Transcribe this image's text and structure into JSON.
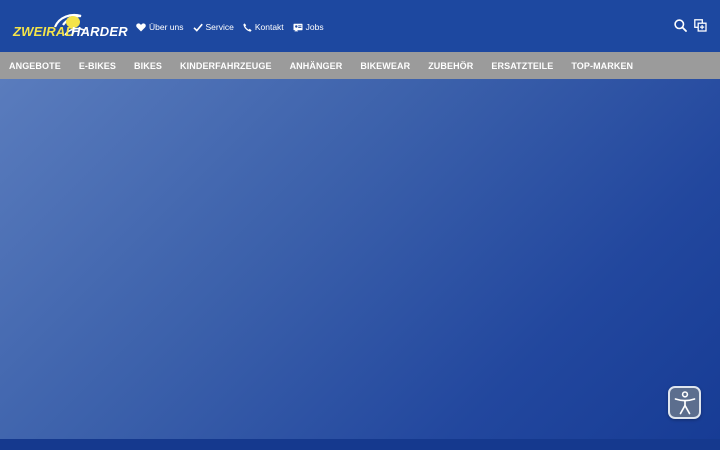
{
  "brand": {
    "logo_left": "ZWEIRAD",
    "logo_right": "HARDER",
    "logo_yellow": "#f4e34a",
    "icon": "bicycle-swoosh-icon"
  },
  "service_nav": [
    {
      "label": "Über uns",
      "icon": "heart-icon"
    },
    {
      "label": "Service",
      "icon": "check-icon"
    },
    {
      "label": "Kontakt",
      "icon": "phone-icon"
    },
    {
      "label": "Jobs",
      "icon": "job-icon"
    }
  ],
  "tools": [
    {
      "icon": "search-icon"
    },
    {
      "icon": "compare-icon"
    }
  ],
  "main_nav": [
    "ANGEBOTE",
    "E-BIKES",
    "BIKES",
    "KINDERFAHRZEUGE",
    "ANHÄNGER",
    "BIKEWEAR",
    "ZUBEHÖR",
    "ERSATZTEILE",
    "TOP-MARKEN"
  ],
  "accessibility": {
    "icon": "accessibility-person-icon"
  },
  "colors": {
    "header_bg": "#1d48a0",
    "nav_bg": "#9b9b9b",
    "hero_light": "#5a7cbd",
    "hero_dark": "#173c95"
  }
}
